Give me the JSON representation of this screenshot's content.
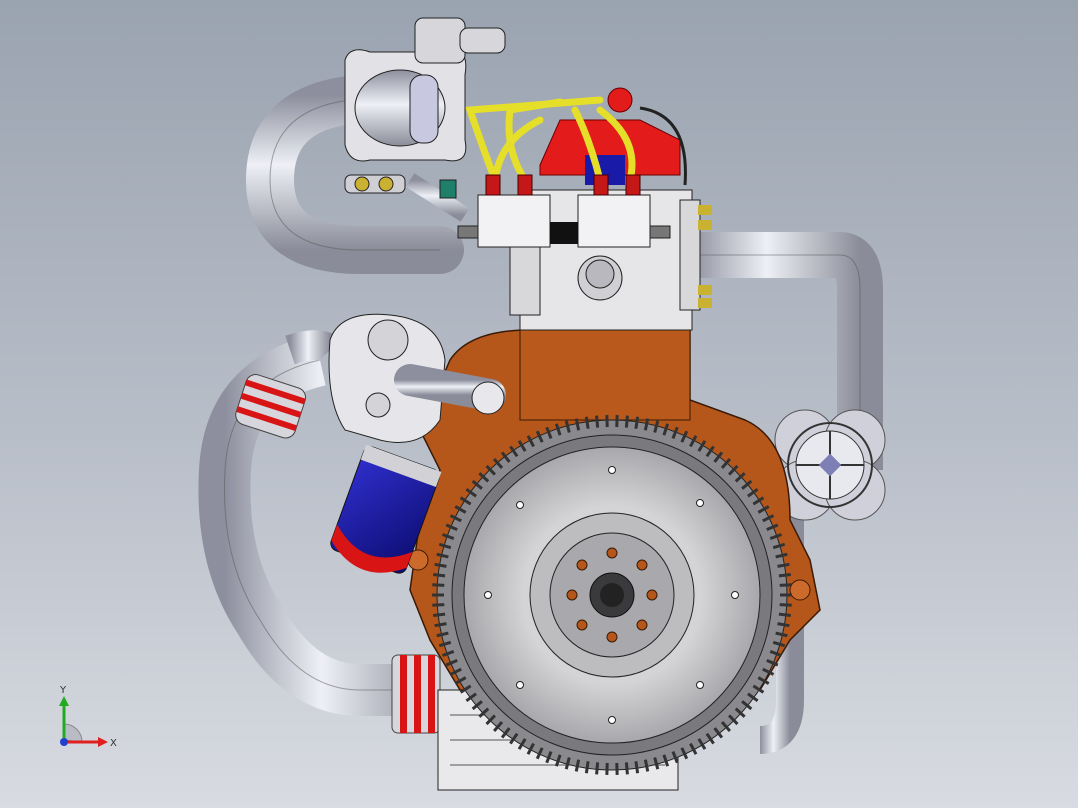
{
  "scene": {
    "description_free": true,
    "colors": {
      "background_top": "#9aa3b0",
      "background_bottom": "#d8dbe1",
      "flywheel_ring": "#6e6e72",
      "flywheel_face": "#c9c9cc",
      "engine_block": "#b5571b",
      "head_cover": "#dcdcdc",
      "distributor_red": "#e41b1b",
      "ignition_wires": "#e6df2a",
      "oil_filter_blue": "#1a1aa8",
      "pipe_silver": "#c7c8d4"
    }
  },
  "triad": {
    "x_label": "X",
    "y_label": "Y",
    "x_color": "#e02020",
    "y_color": "#22aa22",
    "z_color": "#2040d0"
  }
}
